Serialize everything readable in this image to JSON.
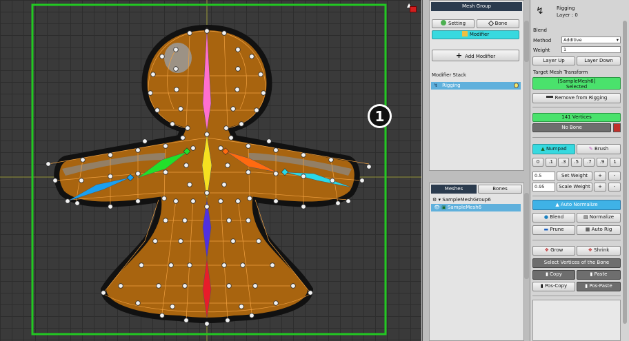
{
  "step_badge": "1",
  "mesh_group": {
    "header": "Mesh Group",
    "setting_label": "Setting",
    "bone_label": "Bone",
    "modifier_label": "Modifier",
    "add_modifier_label": "Add Modifier",
    "modifier_stack_label": "Modifier Stack",
    "stack_items": [
      "Rigging"
    ]
  },
  "hierarchy": {
    "tab_meshes": "Meshes",
    "tab_bones": "Bones",
    "group_name": "SampleMeshGroup6",
    "mesh_name": "SampleMesh6"
  },
  "inspector": {
    "title": "Rigging",
    "layer": "Layer : 0",
    "blend_label": "Blend",
    "method_label": "Method",
    "method_value": "Additive",
    "weight_label": "Weight",
    "weight_value": "1",
    "layer_up": "Layer Up",
    "layer_down": "Layer Down",
    "target_label": "Target Mesh Transform",
    "target_line1": "[SampleMesh6]",
    "target_line2": "Selected",
    "remove_label": "Remove from Rigging",
    "vertices_status": "141 Vertices",
    "no_bone": "No Bone",
    "numpad": "Numpad",
    "brush": "Brush",
    "num_buttons": [
      "0",
      ".1",
      ".3",
      ".5",
      ".7",
      ".9",
      "1"
    ],
    "set_weight_value": "0.5",
    "set_weight_label": "Set Weight",
    "scale_weight_value": "0.95",
    "scale_weight_label": "Scale Weight",
    "plus": "+",
    "minus": "-",
    "auto_normalize": "Auto Normalize",
    "blend": "Blend",
    "normalize": "Normalize",
    "prune": "Prune",
    "auto_rig": "Auto Rig",
    "grow": "Grow",
    "shrink": "Shrink",
    "select_vertices": "Select Vertices of the Bone",
    "copy": "Copy",
    "paste": "Paste",
    "pos_copy": "Pos-Copy",
    "pos_paste": "Pos-Paste"
  },
  "colors": {
    "selection_frame": "#22c822",
    "body_fill": "#a8640f",
    "mesh_edge": "#f0a040",
    "accent_cyan": "#37d9df",
    "status_green": "#4ae26c"
  }
}
